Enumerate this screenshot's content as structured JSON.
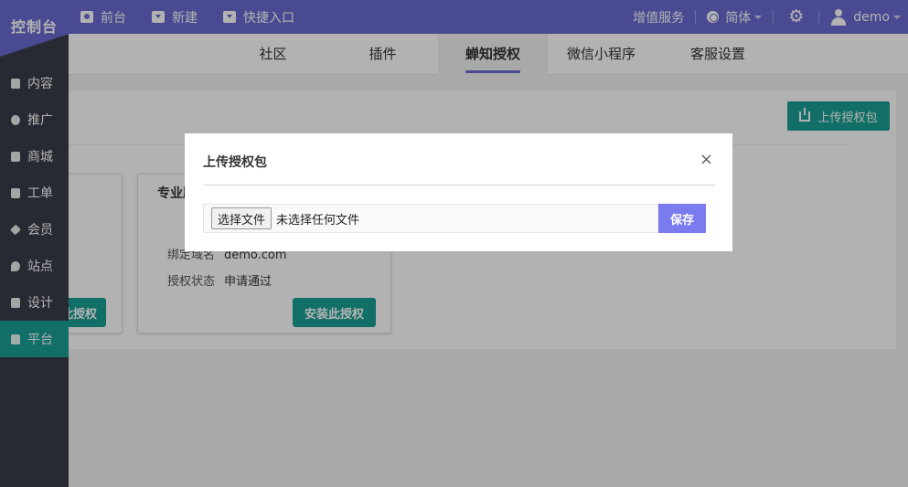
{
  "app": {
    "logo": "控制台"
  },
  "topnav": {
    "items": [
      {
        "label": "前台",
        "icon": "eye-icon"
      },
      {
        "label": "新建",
        "icon": "caret-box-icon"
      },
      {
        "label": "快捷入口",
        "icon": "caret-box-icon"
      }
    ]
  },
  "topright": {
    "value_added": "增值服务",
    "language": "简体",
    "user": "demo"
  },
  "sidebar": {
    "items": [
      {
        "label": "内容"
      },
      {
        "label": "推广"
      },
      {
        "label": "商城"
      },
      {
        "label": "工单"
      },
      {
        "label": "会员"
      },
      {
        "label": "站点"
      },
      {
        "label": "设计"
      },
      {
        "label": "平台",
        "active": true
      }
    ]
  },
  "tabs": [
    {
      "label": "社区"
    },
    {
      "label": "插件"
    },
    {
      "label": "蝉知授权",
      "active": true
    },
    {
      "label": "微信小程序"
    },
    {
      "label": "客服设置"
    }
  ],
  "main": {
    "upload_button": "上传授权包",
    "card_left": {
      "install_label": "装此授权"
    },
    "card_right": {
      "title": "专业版",
      "domain_label": "绑定域名",
      "domain_value": "demo.com",
      "status_label": "授权状态",
      "status_value": "申请通过",
      "install_label": "安装此授权"
    }
  },
  "modal": {
    "title": "上传授权包",
    "close": "×",
    "file_button": "选择文件",
    "file_status": "未选择任何文件",
    "save": "保存"
  },
  "colors": {
    "brand": "#6b6bd2",
    "accent": "#1aa094",
    "sidebar": "#393d49",
    "save": "#7b7bf0"
  }
}
